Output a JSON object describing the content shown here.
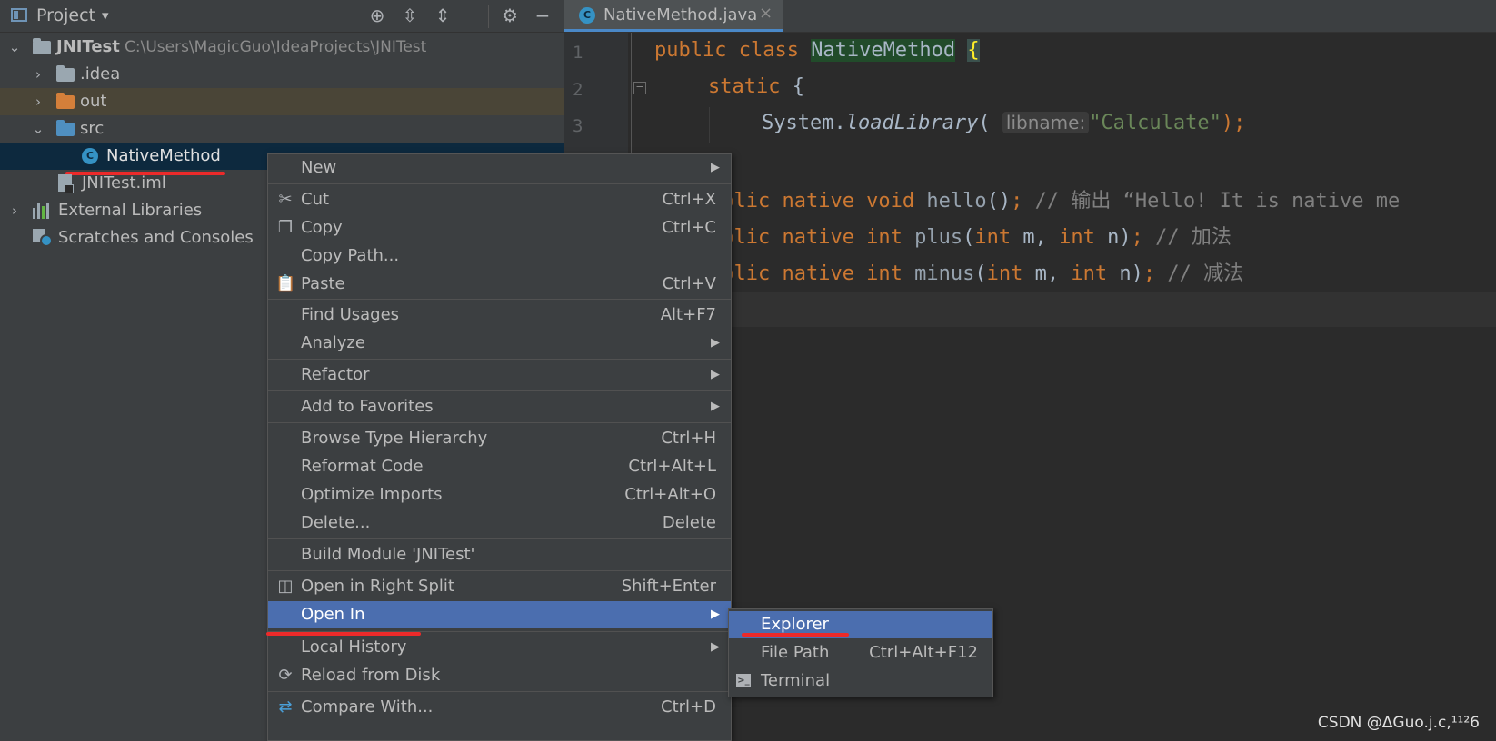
{
  "project_panel": {
    "title": "Project",
    "caret": "▾",
    "toolbar_icons": [
      "locate-icon",
      "expand-all-icon",
      "collapse-all-icon",
      "gear-icon",
      "minimize-icon"
    ],
    "tree": {
      "root_label": "JNITest",
      "root_path": "C:\\Users\\MagicGuo\\IdeaProjects\\JNITest",
      "idea": ".idea",
      "out": "out",
      "src": "src",
      "native_method": "NativeMethod",
      "iml": "JNITest.iml",
      "external_libraries": "External Libraries",
      "scratches": "Scratches and Consoles"
    }
  },
  "editor": {
    "tab_label": "NativeMethod.java",
    "tab_close": "×",
    "line_numbers": [
      "1",
      "2",
      "3"
    ],
    "code": {
      "l1_kw": "public class ",
      "l1_cls": "NativeMethod",
      "l1_brace": "{",
      "l2_kw": "static",
      "l2_rest": " {",
      "l3_a": "System.",
      "l3_method": "loadLibrary",
      "l3_paren": "(",
      "l3_hint": "libname:",
      "l3_str": "\"Calculate\"",
      "l3_end": ");",
      "l5_kw": "ublic native void ",
      "l5_name": "hello",
      "l5_paren": "()",
      "l5_semi": ";",
      "l5_cmt": " // 输出 “Hello! It is native me",
      "l6_kw": "ublic native int ",
      "l6_name": "plus",
      "l6_a": "(",
      "l6_int1": "int",
      "l6_m": " m, ",
      "l6_int2": "int",
      "l6_n": " n)",
      "l6_semi": ";",
      "l6_cmt": " // 加法",
      "l7_kw": "ublic native int ",
      "l7_name": "minus",
      "l7_a": "(",
      "l7_int1": "int",
      "l7_m": " m, ",
      "l7_int2": "int",
      "l7_n": " n)",
      "l7_semi": ";",
      "l7_cmt": " // 减法"
    }
  },
  "context_menu": {
    "items": [
      {
        "label": "New",
        "shortcut": "",
        "submenu": true
      },
      {
        "label": "Cut",
        "shortcut": "Ctrl+X",
        "icon": "scissors-icon"
      },
      {
        "label": "Copy",
        "shortcut": "Ctrl+C",
        "icon": "copy-icon"
      },
      {
        "label": "Copy Path...",
        "shortcut": ""
      },
      {
        "label": "Paste",
        "shortcut": "Ctrl+V",
        "icon": "paste-icon"
      },
      {
        "label": "Find Usages",
        "shortcut": "Alt+F7"
      },
      {
        "label": "Analyze",
        "shortcut": "",
        "submenu": true
      },
      {
        "label": "Refactor",
        "shortcut": "",
        "submenu": true
      },
      {
        "label": "Add to Favorites",
        "shortcut": "",
        "submenu": true
      },
      {
        "label": "Browse Type Hierarchy",
        "shortcut": "Ctrl+H"
      },
      {
        "label": "Reformat Code",
        "shortcut": "Ctrl+Alt+L"
      },
      {
        "label": "Optimize Imports",
        "shortcut": "Ctrl+Alt+O"
      },
      {
        "label": "Delete...",
        "shortcut": "Delete"
      },
      {
        "label": "Build Module 'JNITest'",
        "shortcut": ""
      },
      {
        "label": "Open in Right Split",
        "shortcut": "Shift+Enter",
        "icon": "split-icon"
      },
      {
        "label": "Open In",
        "shortcut": "",
        "submenu": true,
        "active": true
      },
      {
        "label": "Local History",
        "shortcut": "",
        "submenu": true
      },
      {
        "label": "Reload from Disk",
        "shortcut": "",
        "icon": "reload-icon"
      },
      {
        "label": "Compare With...",
        "shortcut": "Ctrl+D",
        "icon": "compare-icon"
      }
    ],
    "submenu_arrow": "▶"
  },
  "submenu": {
    "items": [
      {
        "label": "Explorer",
        "shortcut": "",
        "active": true
      },
      {
        "label": "File Path",
        "shortcut": "Ctrl+Alt+F12"
      },
      {
        "label": "Terminal",
        "shortcut": "",
        "icon": "terminal-icon"
      }
    ]
  },
  "watermark": "CSDN @ΔGuo.j.c,¹¹²6",
  "colors": {
    "panel_bg": "#3c3f41",
    "editor_bg": "#2b2b2b",
    "selection": "#4b6eaf",
    "keyword": "#cc7832",
    "string": "#6a8759",
    "annotation_red": "#ec2a2a"
  }
}
